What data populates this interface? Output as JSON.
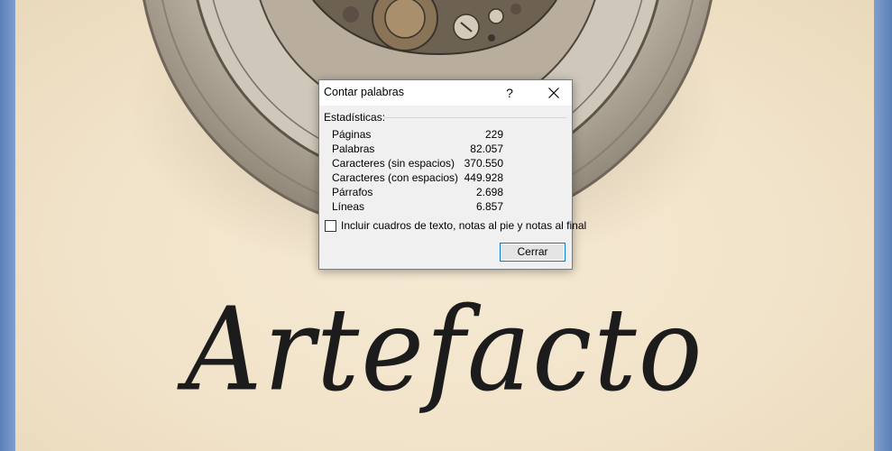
{
  "cover": {
    "title": "Artefacto"
  },
  "dialog": {
    "title": "Contar palabras",
    "help_label": "?",
    "section_label": "Estadísticas:",
    "stats": [
      {
        "label": "Páginas",
        "value": "229"
      },
      {
        "label": "Palabras",
        "value": "82.057"
      },
      {
        "label": "Caracteres (sin espacios)",
        "value": "370.550"
      },
      {
        "label": "Caracteres (con espacios)",
        "value": "449.928"
      },
      {
        "label": "Párrafos",
        "value": "2.698"
      },
      {
        "label": "Líneas",
        "value": "6.857"
      }
    ],
    "include_label": "Incluir cuadros de texto, notas al pie y notas al final",
    "include_checked": false,
    "close_button_label": "Cerrar",
    "icons": {
      "close": "close-icon"
    }
  },
  "colors": {
    "accent": "#0078d7",
    "page_background": "#f1e3c9",
    "window_frame": "#6f8fbf"
  }
}
